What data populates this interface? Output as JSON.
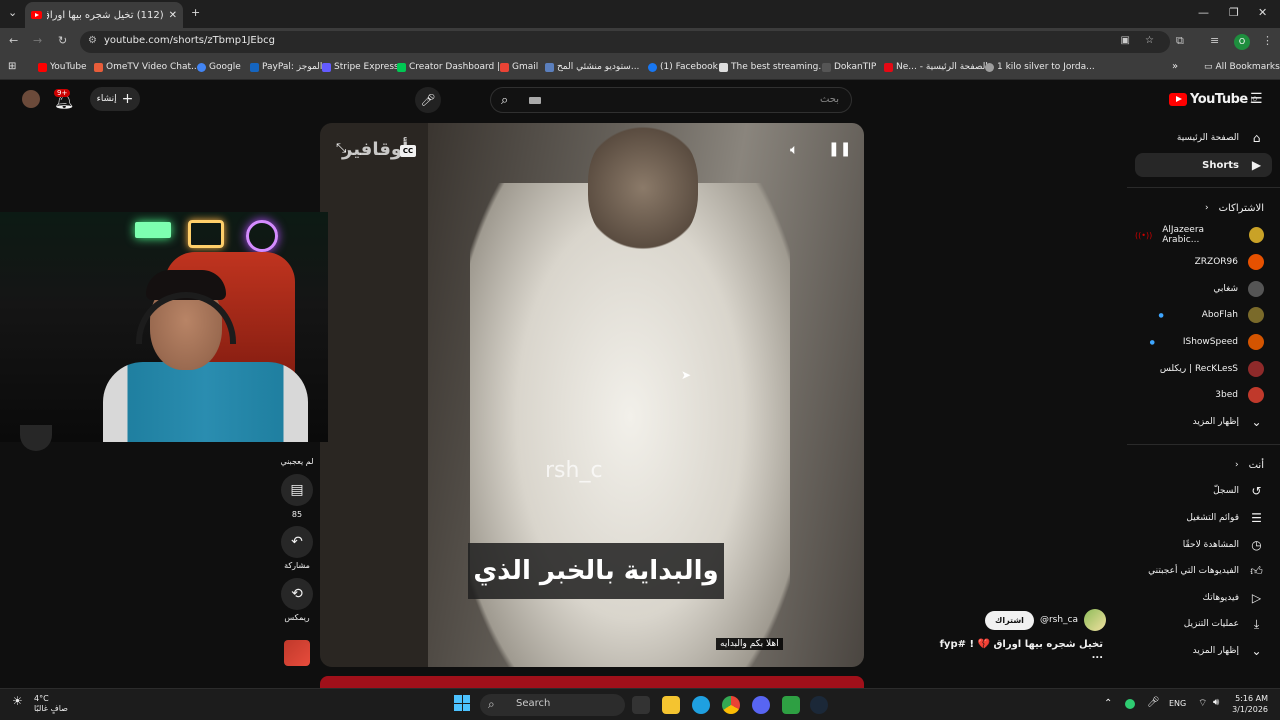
{
  "browser": {
    "tab_title": "(112) تخيل شجره بيها اوراق 💔",
    "url": "youtube.com/shorts/zTbmp1JEbcg",
    "profile_initial": "O"
  },
  "bookmarks": [
    {
      "label": "YouTube",
      "color": "#ff0000"
    },
    {
      "label": "OmeTV Video Chat...",
      "color": "#e85d3a"
    },
    {
      "label": "Google",
      "color": "#4285f4"
    },
    {
      "label": "PayPal: الموجز",
      "color": "#1565c0"
    },
    {
      "label": "Stripe Express",
      "color": "#635bff"
    },
    {
      "label": "Creator Dashboard |...",
      "color": "#00c853"
    },
    {
      "label": "Gmail",
      "color": "#ea4335"
    },
    {
      "label": "ستوديو منشئي المح...",
      "color": "#5b7fbd"
    },
    {
      "label": "(1) Facebook",
      "color": "#1877f2"
    },
    {
      "label": "The best streaming...",
      "color": "#dddddd"
    },
    {
      "label": "DokanTIP",
      "color": "#333333"
    },
    {
      "label": "Ne... - الصفحة الرئيسية",
      "color": "#e50914"
    },
    {
      "label": "1 kilo silver to Jorda...",
      "color": "#9e9e9e"
    }
  ],
  "all_bookmarks": "All Bookmarks",
  "header": {
    "search_placeholder": "بحث",
    "create_label": "إنشاء",
    "notif_count": "9+",
    "logo_text": "YouTube",
    "logo_region": "JO"
  },
  "sidebar": {
    "home": "الصفحة الرئيسية",
    "shorts": "Shorts",
    "subscriptions_heading": "الاشتراكات",
    "subscriptions": [
      {
        "name": "AlJazeera Arabic...",
        "color": "#c9a227",
        "live": true
      },
      {
        "name": "ZRZOR96",
        "color": "#e65100",
        "live": false
      },
      {
        "name": "شغابي",
        "color": "#555555",
        "live": false
      },
      {
        "name": "AboFlah",
        "color": "#7a6a2a",
        "live": false,
        "dot": true
      },
      {
        "name": "IShowSpeed",
        "color": "#d35400",
        "live": false,
        "dot": true
      },
      {
        "name": "ريكلس | RecKLesS",
        "color": "#8e2a2a",
        "live": false
      },
      {
        "name": "3bed",
        "color": "#c0392b",
        "live": false
      }
    ],
    "show_more": "إظهار المزيد",
    "you_heading": "أنت",
    "you_items": [
      {
        "label": "السجلّ",
        "icon": "history-icon"
      },
      {
        "label": "قوائم التشغيل",
        "icon": "playlist-icon"
      },
      {
        "label": "المشاهدة لاحقًا",
        "icon": "clock-icon"
      },
      {
        "label": "الفيديوهات التي أعجبتني",
        "icon": "thumbs-up-icon"
      },
      {
        "label": "فيديوهاتك",
        "icon": "play-icon"
      },
      {
        "label": "عمليات التنزيل",
        "icon": "download-icon"
      }
    ],
    "show_more_2": "إظهار المزيد"
  },
  "video": {
    "channel_watermark": "أوقافير",
    "watermark_text": "rsh_c",
    "subtitle_main": "والبداية بالخبر الذي",
    "subtitle_small": "اهلا بكم والبدايه",
    "cc_label": "CC"
  },
  "actions": {
    "dislike_label": "لم يعجبني",
    "comments_count": "85",
    "share_label": "مشاركة",
    "remix_label": "ريمكس"
  },
  "info": {
    "channel_handle": "@rsh_ca",
    "subscribe_label": "اشتراك",
    "title": "تخيل شجره بيها اوراق 💔 ! #fyp ..."
  },
  "taskbar": {
    "weather_temp": "4°C",
    "weather_desc": "صافٍ غالبًا",
    "search_label": "Search",
    "language": "ENG",
    "time": "5:16 AM",
    "date": "3/1/2026"
  }
}
